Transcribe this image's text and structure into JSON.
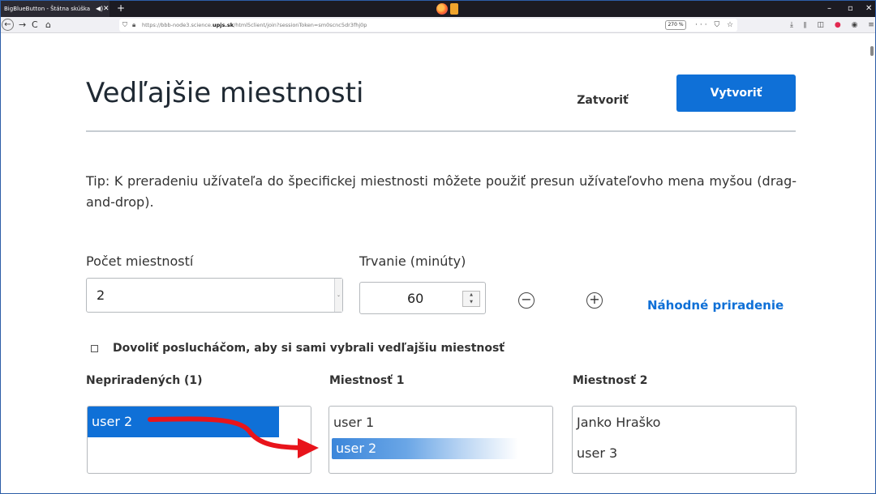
{
  "browser": {
    "tab_title": "BigBlueButton - Štátna skúška",
    "speaker_glyph": "◀)",
    "close_glyph": "✕",
    "newtab_glyph": "+",
    "minimize_glyph": "–",
    "restore_glyph": "▫",
    "winclose_glyph": "✕",
    "back_glyph": "←",
    "forward_glyph": "→",
    "reload_glyph": "C",
    "home_glyph": "⌂",
    "url_prefix": "https://bbb-node3.science.",
    "url_domain": "upjs.sk",
    "url_suffix": "/html5client/join?sessionToken=sm0scnc5dr3fhj0p",
    "zoom": "270 %",
    "url_actions": "··· ⛉ ☆",
    "toolbar": "⤓ ⫴ ◫",
    "toolbar_red": "●",
    "toolbar_end": "◉ ≡",
    "shield_glyph": "⛉",
    "lock_glyph": "🔒︎"
  },
  "header": {
    "title": "Vedľajšie miestnosti",
    "close_label": "Zatvoriť",
    "create_label": "Vytvoriť"
  },
  "tip": "Tip: K preradeniu užívateľa do špecifickej miestnosti môžete použiť presun užívateľovho mena myšou (drag-and-drop).",
  "form": {
    "rooms_label": "Počet miestností",
    "rooms_value": "2",
    "select_arrow": "⌄",
    "duration_label": "Trvanie (minúty)",
    "duration_value": "60",
    "spin_up": "▲",
    "spin_down": "▼",
    "minus_glyph": "−",
    "plus_glyph": "+",
    "random_label": "Náhodné priradenie"
  },
  "checkbox": {
    "label": "Dovoliť poslucháčom, aby si sami vybrali vedľajšiu miestnosť",
    "checked": false
  },
  "columns": [
    {
      "heading": "Nepriradených (1)",
      "users": [
        "user 2"
      ],
      "selected": "user 2"
    },
    {
      "heading": "Miestnosť 1",
      "users": [
        "user 1"
      ],
      "drop_ghost": "user 2"
    },
    {
      "heading": "Miestnosť 2",
      "users": [
        "Janko Hraško",
        "user 3"
      ]
    }
  ],
  "colors": {
    "primary": "#0f70d7",
    "arrow": "#e8141b",
    "rule": "#c6ccd2"
  }
}
